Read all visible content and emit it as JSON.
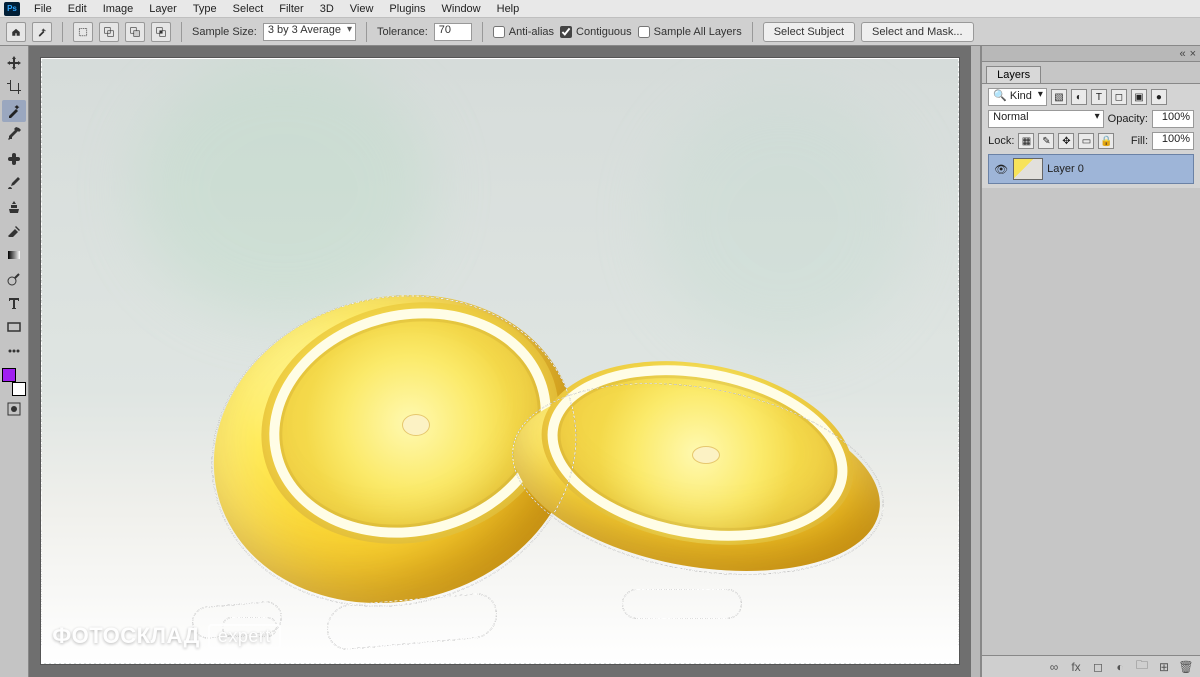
{
  "app": {
    "logo_text": "Ps"
  },
  "menu": {
    "file": "File",
    "edit": "Edit",
    "image": "Image",
    "layer": "Layer",
    "type": "Type",
    "select": "Select",
    "filter": "Filter",
    "threeD": "3D",
    "view": "View",
    "plugins": "Plugins",
    "window": "Window",
    "help": "Help"
  },
  "options": {
    "sample_size_label": "Sample Size:",
    "sample_size_value": "3 by 3 Average",
    "tolerance_label": "Tolerance:",
    "tolerance_value": "70",
    "anti_alias_label": "Anti-alias",
    "anti_alias_checked": false,
    "contiguous_label": "Contiguous",
    "contiguous_checked": true,
    "sample_all_label": "Sample All Layers",
    "sample_all_checked": false,
    "select_subject": "Select Subject",
    "select_and_mask": "Select and Mask..."
  },
  "tools": {
    "foreground_color": "#a020f0",
    "background_color": "#ffffff",
    "active_tool": "magic-wand"
  },
  "watermark": {
    "brand": "ФОТОСКЛАД",
    "tag": "expert"
  },
  "layers_panel": {
    "tab_label": "Layers",
    "filter_kind": "Kind",
    "blend_mode": "Normal",
    "opacity_label": "Opacity:",
    "opacity_value": "100%",
    "lock_label": "Lock:",
    "fill_label": "Fill:",
    "fill_value": "100%",
    "layers": [
      {
        "name": "Layer 0",
        "visible": true
      }
    ],
    "footer_link": "∞",
    "footer_fx": "fx"
  }
}
